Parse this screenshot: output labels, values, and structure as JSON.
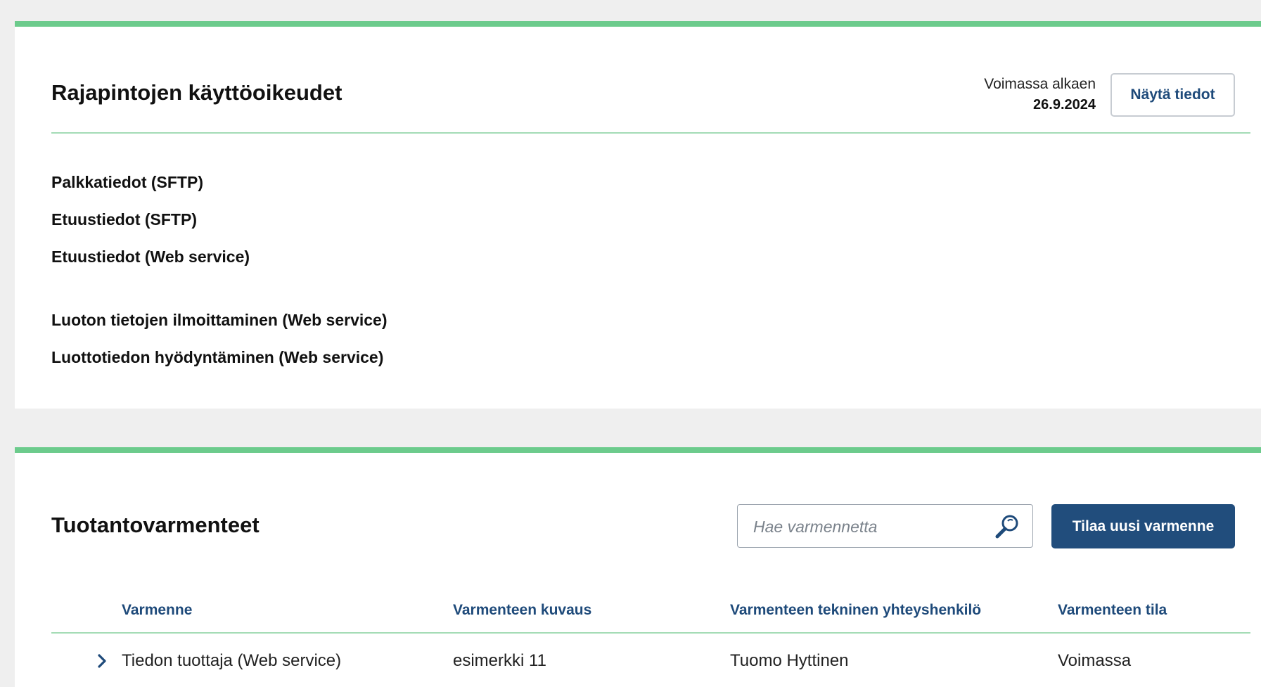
{
  "api_rights": {
    "title": "Rajapintojen käyttöoikeudet",
    "valid_from_label": "Voimassa alkaen",
    "valid_from_date": "26.9.2024",
    "show_details_label": "Näytä tiedot",
    "items": [
      "Palkkatiedot (SFTP)",
      "Etuustiedot (SFTP)",
      "Etuustiedot (Web service)",
      "Luoton tietojen ilmoittaminen (Web service)",
      "Luottotiedon hyödyntäminen (Web service)"
    ]
  },
  "certificates": {
    "title": "Tuotantovarmenteet",
    "search_placeholder": "Hae varmennetta",
    "search_icon": "magnifier-icon",
    "order_button_label": "Tilaa uusi varmenne",
    "columns": [
      "Varmenne",
      "Varmenteen kuvaus",
      "Varmenteen tekninen yhteyshenkilö",
      "Varmenteen tila"
    ],
    "rows": [
      {
        "name": "Tiedon tuottaja (Web service)",
        "description": "esimerkki 11",
        "contact": "Tuomo Hyttinen",
        "status": "Voimassa"
      }
    ]
  },
  "colors": {
    "accent_green": "#6ccb8c",
    "primary_blue": "#214d7c",
    "header_blue": "#1e4a7a"
  }
}
